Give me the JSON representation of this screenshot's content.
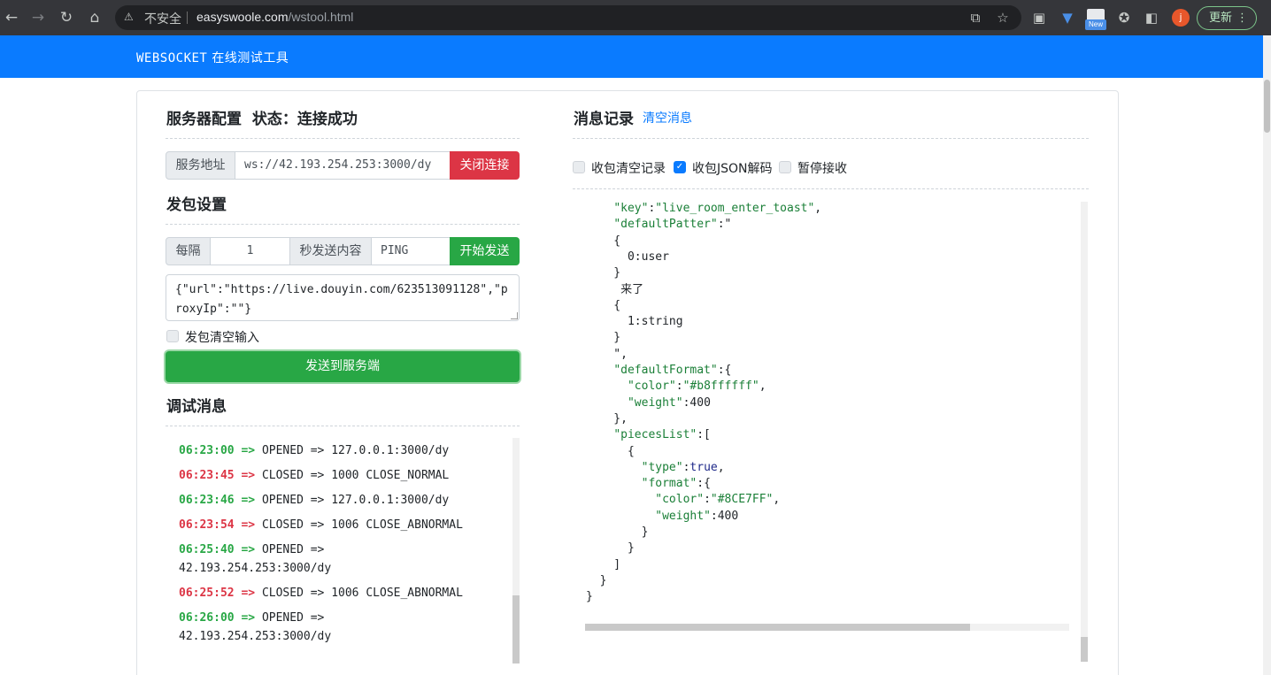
{
  "browser": {
    "insecure_label": "不安全",
    "url_host": "easyswoole.com",
    "url_path": "/wstool.html",
    "new_badge": "New",
    "avatar_letter": "j",
    "update_label": "更新"
  },
  "header": {
    "title_en": "WEBSOCKET",
    "title_cn": "在线测试工具"
  },
  "server": {
    "heading": "服务器配置",
    "status_label": "状态：连接成功",
    "addr_label": "服务地址",
    "addr_value": "ws://42.193.254.253:3000/dy",
    "close_button": "关闭连接"
  },
  "send": {
    "heading": "发包设置",
    "every_label": "每隔",
    "interval_value": "1",
    "content_label": "秒发送内容",
    "content_value": "PING",
    "start_button": "开始发送",
    "payload": "{\"url\":\"https://live.douyin.com/623513091128\",\"proxyIp\":\"\"}",
    "clear_input_label": "发包清空输入",
    "send_button": "发送到服务端"
  },
  "debug": {
    "heading": "调试消息",
    "entries": [
      {
        "time": "06:23:00",
        "arrow": "=>",
        "text": "OPENED => 127.0.0.1:3000/dy",
        "type": "open"
      },
      {
        "time": "06:23:45",
        "arrow": "=>",
        "text": "CLOSED => 1000 CLOSE_NORMAL",
        "type": "close"
      },
      {
        "time": "06:23:46",
        "arrow": "=>",
        "text": "OPENED => 127.0.0.1:3000/dy",
        "type": "open"
      },
      {
        "time": "06:23:54",
        "arrow": "=>",
        "text": "CLOSED => 1006 CLOSE_ABNORMAL",
        "type": "close"
      },
      {
        "time": "06:25:40",
        "arrow": "=>",
        "text": "OPENED =>",
        "text2": "42.193.254.253:3000/dy",
        "type": "open"
      },
      {
        "time": "06:25:52",
        "arrow": "=>",
        "text": "CLOSED => 1006 CLOSE_ABNORMAL",
        "type": "close"
      },
      {
        "time": "06:26:00",
        "arrow": "=>",
        "text": "OPENED =>",
        "text2": "42.193.254.253:3000/dy",
        "type": "open"
      }
    ]
  },
  "messages": {
    "heading": "消息记录",
    "clear_link": "清空消息",
    "opt_clear": "收包清空记录",
    "opt_json": "收包JSON解码",
    "opt_pause": "暂停接收",
    "opt_clear_checked": false,
    "opt_json_checked": true,
    "opt_pause_checked": false,
    "json_lines": [
      "    \"key\":\"live_room_enter_toast\",",
      "    \"defaultPatter\":\"",
      "    {",
      "      0:user",
      "    }",
      "     来了",
      "    {",
      "      1:string",
      "    }",
      "    \",",
      "    \"defaultFormat\":{",
      "      \"color\":\"#b8ffffff\",",
      "      \"weight\":400",
      "    },",
      "    \"piecesList\":[",
      "      {",
      "        \"type\":true,",
      "        \"format\":{",
      "          \"color\":\"#8CE7FF\",",
      "          \"weight\":400",
      "        }",
      "      }",
      "    ]",
      "  }",
      "}"
    ]
  }
}
